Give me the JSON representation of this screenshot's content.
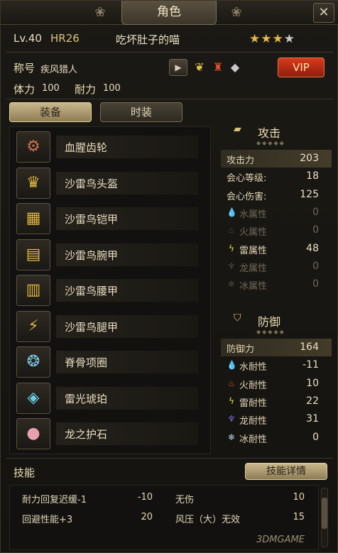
{
  "window": {
    "title": "角色",
    "close_icon": "close-icon"
  },
  "header": {
    "level": "Lv.40",
    "hr": "HR26",
    "name": "吃坏肚子的喵",
    "stars": {
      "filled": 3,
      "total": 4
    },
    "title_label": "称号",
    "title_value": "疾风猎人",
    "vip_label": "VIP",
    "stamina_label": "体力",
    "stamina_value": "100",
    "durability_label": "耐力",
    "durability_value": "100"
  },
  "tabs": [
    {
      "label": "装备",
      "active": true
    },
    {
      "label": "时装",
      "active": false
    }
  ],
  "equipment": [
    {
      "name": "血腥齿轮",
      "icon": "weapon-icon"
    },
    {
      "name": "沙雷鸟头盔",
      "icon": "helmet-icon"
    },
    {
      "name": "沙雷鸟铠甲",
      "icon": "chest-armor-icon"
    },
    {
      "name": "沙雷鸟腕甲",
      "icon": "arm-armor-icon"
    },
    {
      "name": "沙雷鸟腰甲",
      "icon": "waist-armor-icon"
    },
    {
      "name": "沙雷鸟腿甲",
      "icon": "leg-armor-icon"
    },
    {
      "name": "脊骨项圈",
      "icon": "necklace-icon"
    },
    {
      "name": "雷光琥珀",
      "icon": "gem-icon"
    },
    {
      "name": "龙之护石",
      "icon": "talisman-icon"
    }
  ],
  "attack": {
    "header": "攻击",
    "rows": [
      {
        "label": "攻击力",
        "value": "203",
        "highlight": true,
        "dim": false
      },
      {
        "label": "会心等级:",
        "value": "18",
        "highlight": false,
        "dim": false
      },
      {
        "label": "会心伤害:",
        "value": "125",
        "highlight": false,
        "dim": false
      },
      {
        "label": "水属性",
        "value": "0",
        "icon": "water-icon",
        "dim": true
      },
      {
        "label": "火属性",
        "value": "0",
        "icon": "fire-icon",
        "dim": true
      },
      {
        "label": "雷属性",
        "value": "48",
        "icon": "thunder-icon",
        "dim": false
      },
      {
        "label": "龙属性",
        "value": "0",
        "icon": "dragon-icon",
        "dim": true
      },
      {
        "label": "冰属性",
        "value": "0",
        "icon": "ice-icon",
        "dim": true
      }
    ]
  },
  "defense": {
    "header": "防御",
    "rows": [
      {
        "label": "防御力",
        "value": "164",
        "highlight": true,
        "dim": false
      },
      {
        "label": "水耐性",
        "value": "-11",
        "icon": "water-icon",
        "dim": false
      },
      {
        "label": "火耐性",
        "value": "10",
        "icon": "fire-icon",
        "dim": false
      },
      {
        "label": "雷耐性",
        "value": "22",
        "icon": "thunder-icon",
        "dim": false
      },
      {
        "label": "龙耐性",
        "value": "31",
        "icon": "dragon-icon",
        "dim": false
      },
      {
        "label": "冰耐性",
        "value": "0",
        "icon": "ice-icon",
        "dim": false
      }
    ]
  },
  "skills": {
    "label": "技能",
    "details_button": "技能详情",
    "items": [
      {
        "name": "耐力回复迟缓-1",
        "value": "-10"
      },
      {
        "name": "无伤",
        "value": "10"
      },
      {
        "name": "回避性能+3",
        "value": "20"
      },
      {
        "name": "风压（大）无效",
        "value": "15"
      }
    ]
  },
  "colors": {
    "accent_gold": "#d9c27c",
    "vip_red": "#c8321a",
    "thunder": "#e6e23a",
    "fire": "#e2532a",
    "water": "#6fb7e6",
    "dragon": "#7a6ad9",
    "ice": "#b8d8f0"
  },
  "watermark": "3DMGAME"
}
